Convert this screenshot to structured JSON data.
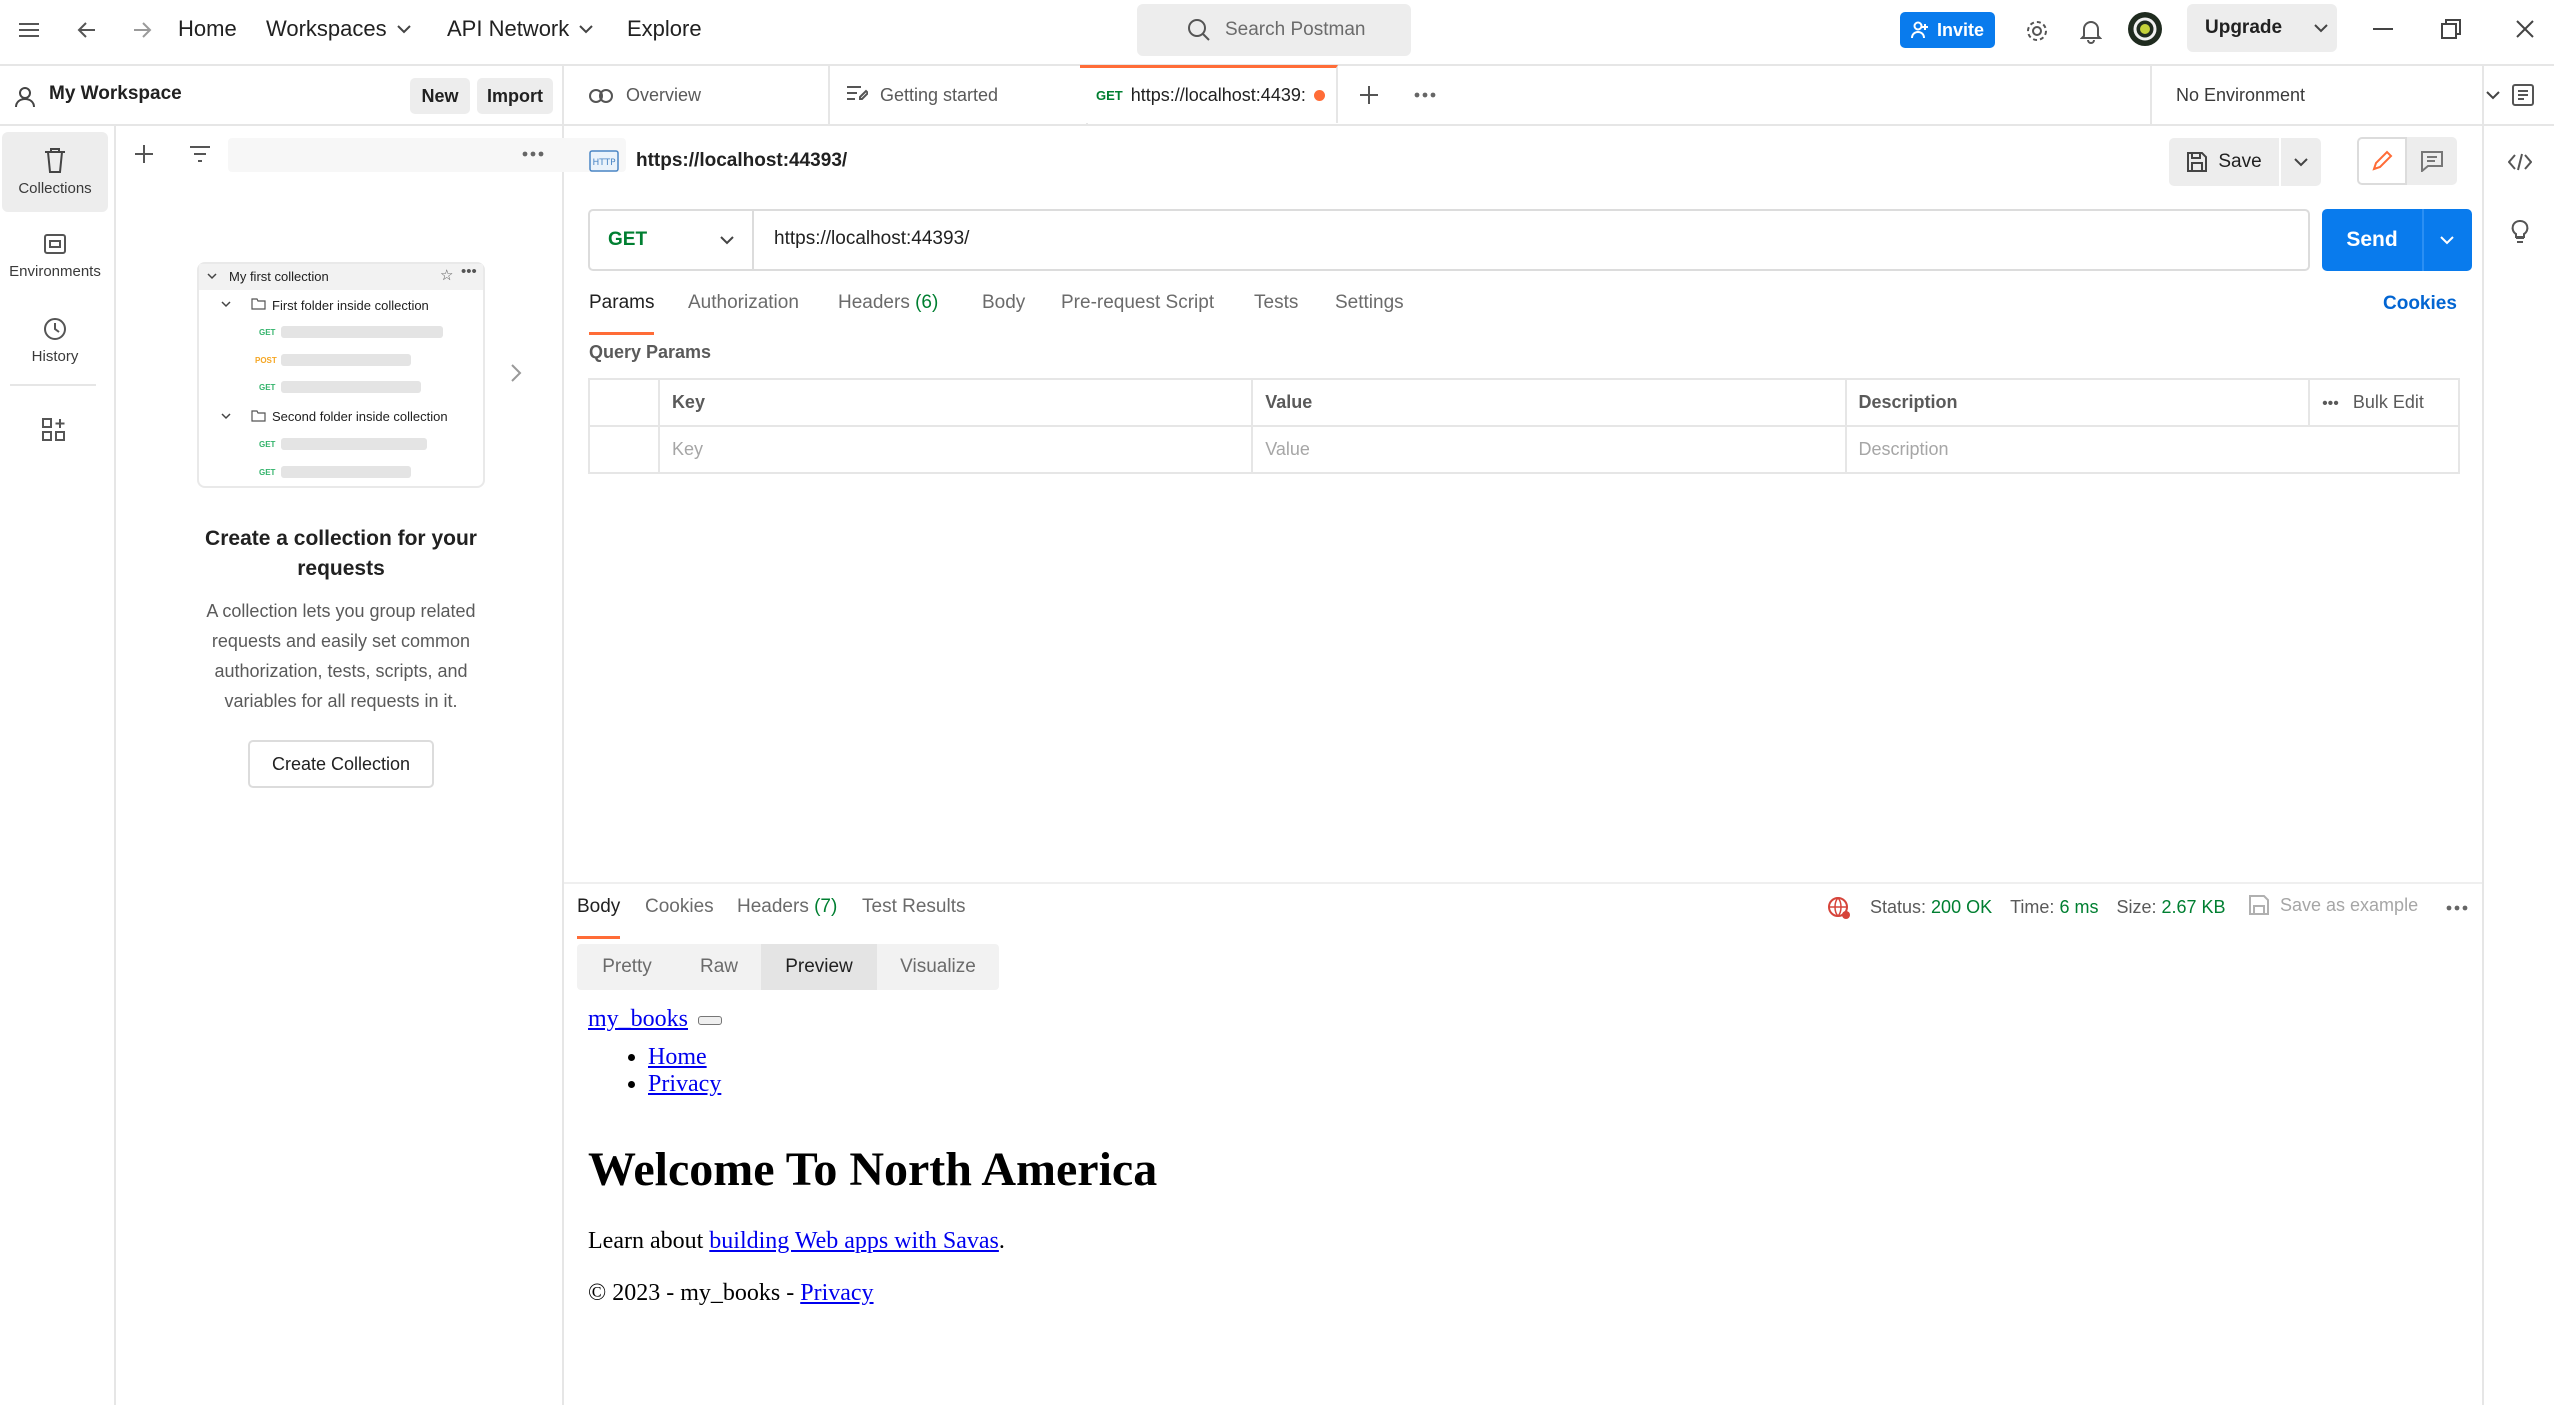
{
  "topbar": {
    "home": "Home",
    "workspaces": "Workspaces",
    "api_network": "API Network",
    "explore": "Explore",
    "search_placeholder": "Search Postman",
    "invite": "Invite",
    "upgrade": "Upgrade"
  },
  "workspace": {
    "name": "My Workspace",
    "new_label": "New",
    "import_label": "Import"
  },
  "rail": {
    "collections": "Collections",
    "environments": "Environments",
    "history": "History"
  },
  "illustration": {
    "collection": "My first collection",
    "folder1": "First folder inside collection",
    "folder2": "Second folder inside collection",
    "methods": [
      "GET",
      "POST",
      "GET",
      "GET",
      "GET"
    ]
  },
  "empty_state": {
    "title": "Create a collection for your requests",
    "description": "A collection lets you group related requests and easily set common authorization, tests, scripts, and variables for all requests in it.",
    "button": "Create Collection"
  },
  "tabs": [
    {
      "label": "Overview"
    },
    {
      "label": "Getting started"
    },
    {
      "method": "GET",
      "label": "https://localhost:4439:"
    }
  ],
  "environment": "No Environment",
  "request": {
    "title": "https://localhost:44393/",
    "save": "Save",
    "method": "GET",
    "url": "https://localhost:44393/",
    "send": "Send",
    "tabs": {
      "params": "Params",
      "authorization": "Authorization",
      "headers": "Headers",
      "headers_count": "(6)",
      "body": "Body",
      "prerequest": "Pre-request Script",
      "tests": "Tests",
      "settings": "Settings"
    },
    "cookies": "Cookies",
    "query_params_label": "Query Params",
    "table": {
      "headers": [
        "Key",
        "Value",
        "Description"
      ],
      "bulk_edit": "Bulk Edit",
      "placeholders": [
        "Key",
        "Value",
        "Description"
      ]
    }
  },
  "response": {
    "tabs": {
      "body": "Body",
      "cookies": "Cookies",
      "headers": "Headers",
      "headers_count": "(7)",
      "test_results": "Test Results"
    },
    "status_label": "Status:",
    "status_value": "200 OK",
    "time_label": "Time:",
    "time_value": "6 ms",
    "size_label": "Size:",
    "size_value": "2.67 KB",
    "save_example": "Save as example",
    "views": [
      "Pretty",
      "Raw",
      "Preview",
      "Visualize"
    ],
    "active_view": "Preview"
  },
  "preview": {
    "brand": "my_books",
    "nav": [
      "Home",
      "Privacy"
    ],
    "heading": "Welcome To North America",
    "learn_prefix": "Learn about ",
    "learn_link": "building Web apps with Savas",
    "learn_suffix": ".",
    "footer_prefix": "© 2023 - my_books - ",
    "footer_link": "Privacy"
  },
  "colors": {
    "accent": "#ff6c37",
    "primary": "#097bed",
    "get": "#007f31",
    "post": "#ad7a03",
    "status_ok": "#007f31"
  }
}
